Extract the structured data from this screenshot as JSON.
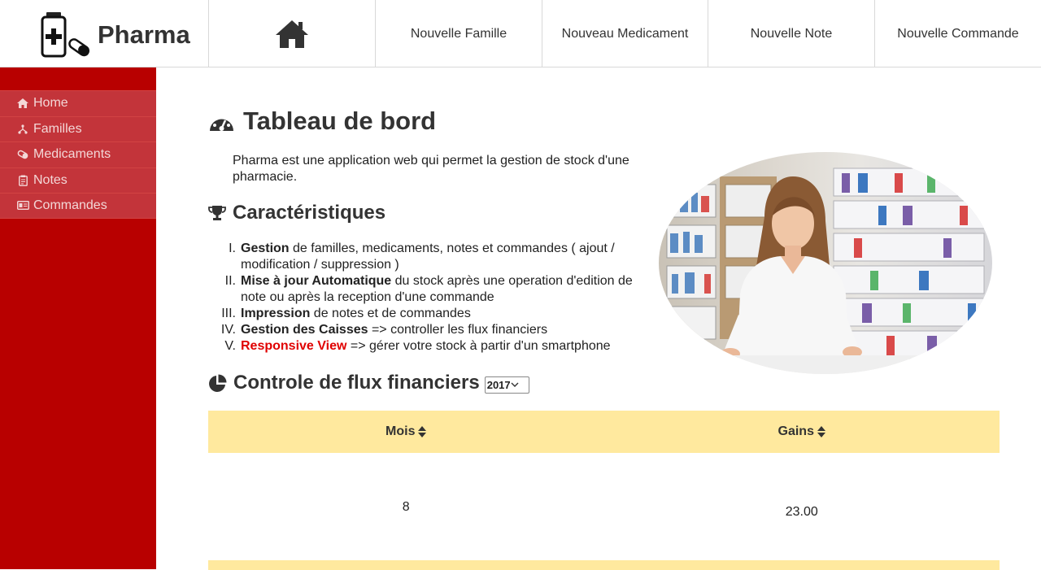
{
  "app": {
    "name": "Pharma"
  },
  "nav": {
    "home_icon": "home-icon",
    "buttons": [
      "Nouvelle Famille",
      "Nouveau Medicament",
      "Nouvelle Note",
      "Nouvelle Commande"
    ]
  },
  "sidebar": {
    "items": [
      {
        "label": "Home",
        "icon": "home-icon"
      },
      {
        "label": "Familles",
        "icon": "sitemap-icon"
      },
      {
        "label": "Medicaments",
        "icon": "pills-icon"
      },
      {
        "label": "Notes",
        "icon": "clipboard-icon"
      },
      {
        "label": "Commandes",
        "icon": "id-card-icon"
      }
    ]
  },
  "main": {
    "title": "Tableau de bord",
    "intro": "Pharma est une application web qui permet la gestion de stock d'une pharmacie.",
    "features_heading": "Caractéristiques",
    "features": [
      {
        "num": "I.",
        "bold": "Gestion",
        "text": " de familles, medicaments, notes et commandes ( ajout / modification / suppression )"
      },
      {
        "num": "II.",
        "bold": "Mise à jour Automatique",
        "text": " du stock après une operation d'edition de note ou après la reception d'une commande"
      },
      {
        "num": "III.",
        "bold": "Impression",
        "text": " de notes et de commandes"
      },
      {
        "num": "IV.",
        "bold": "Gestion des Caisses",
        "text": " => controller les flux financiers"
      },
      {
        "num": "V.",
        "bold": "Responsive View",
        "text": " => gérer votre stock à partir d'un smartphone"
      }
    ],
    "flux_heading": "Controle de flux financiers",
    "year_selected": "2017"
  },
  "table": {
    "headers": [
      "Mois",
      "Gains"
    ],
    "rows": [
      [
        "8",
        "23.00"
      ]
    ]
  },
  "colors": {
    "sidebar": "#b80000",
    "table_header": "#ffe99e",
    "accent_red": "#e00000"
  }
}
